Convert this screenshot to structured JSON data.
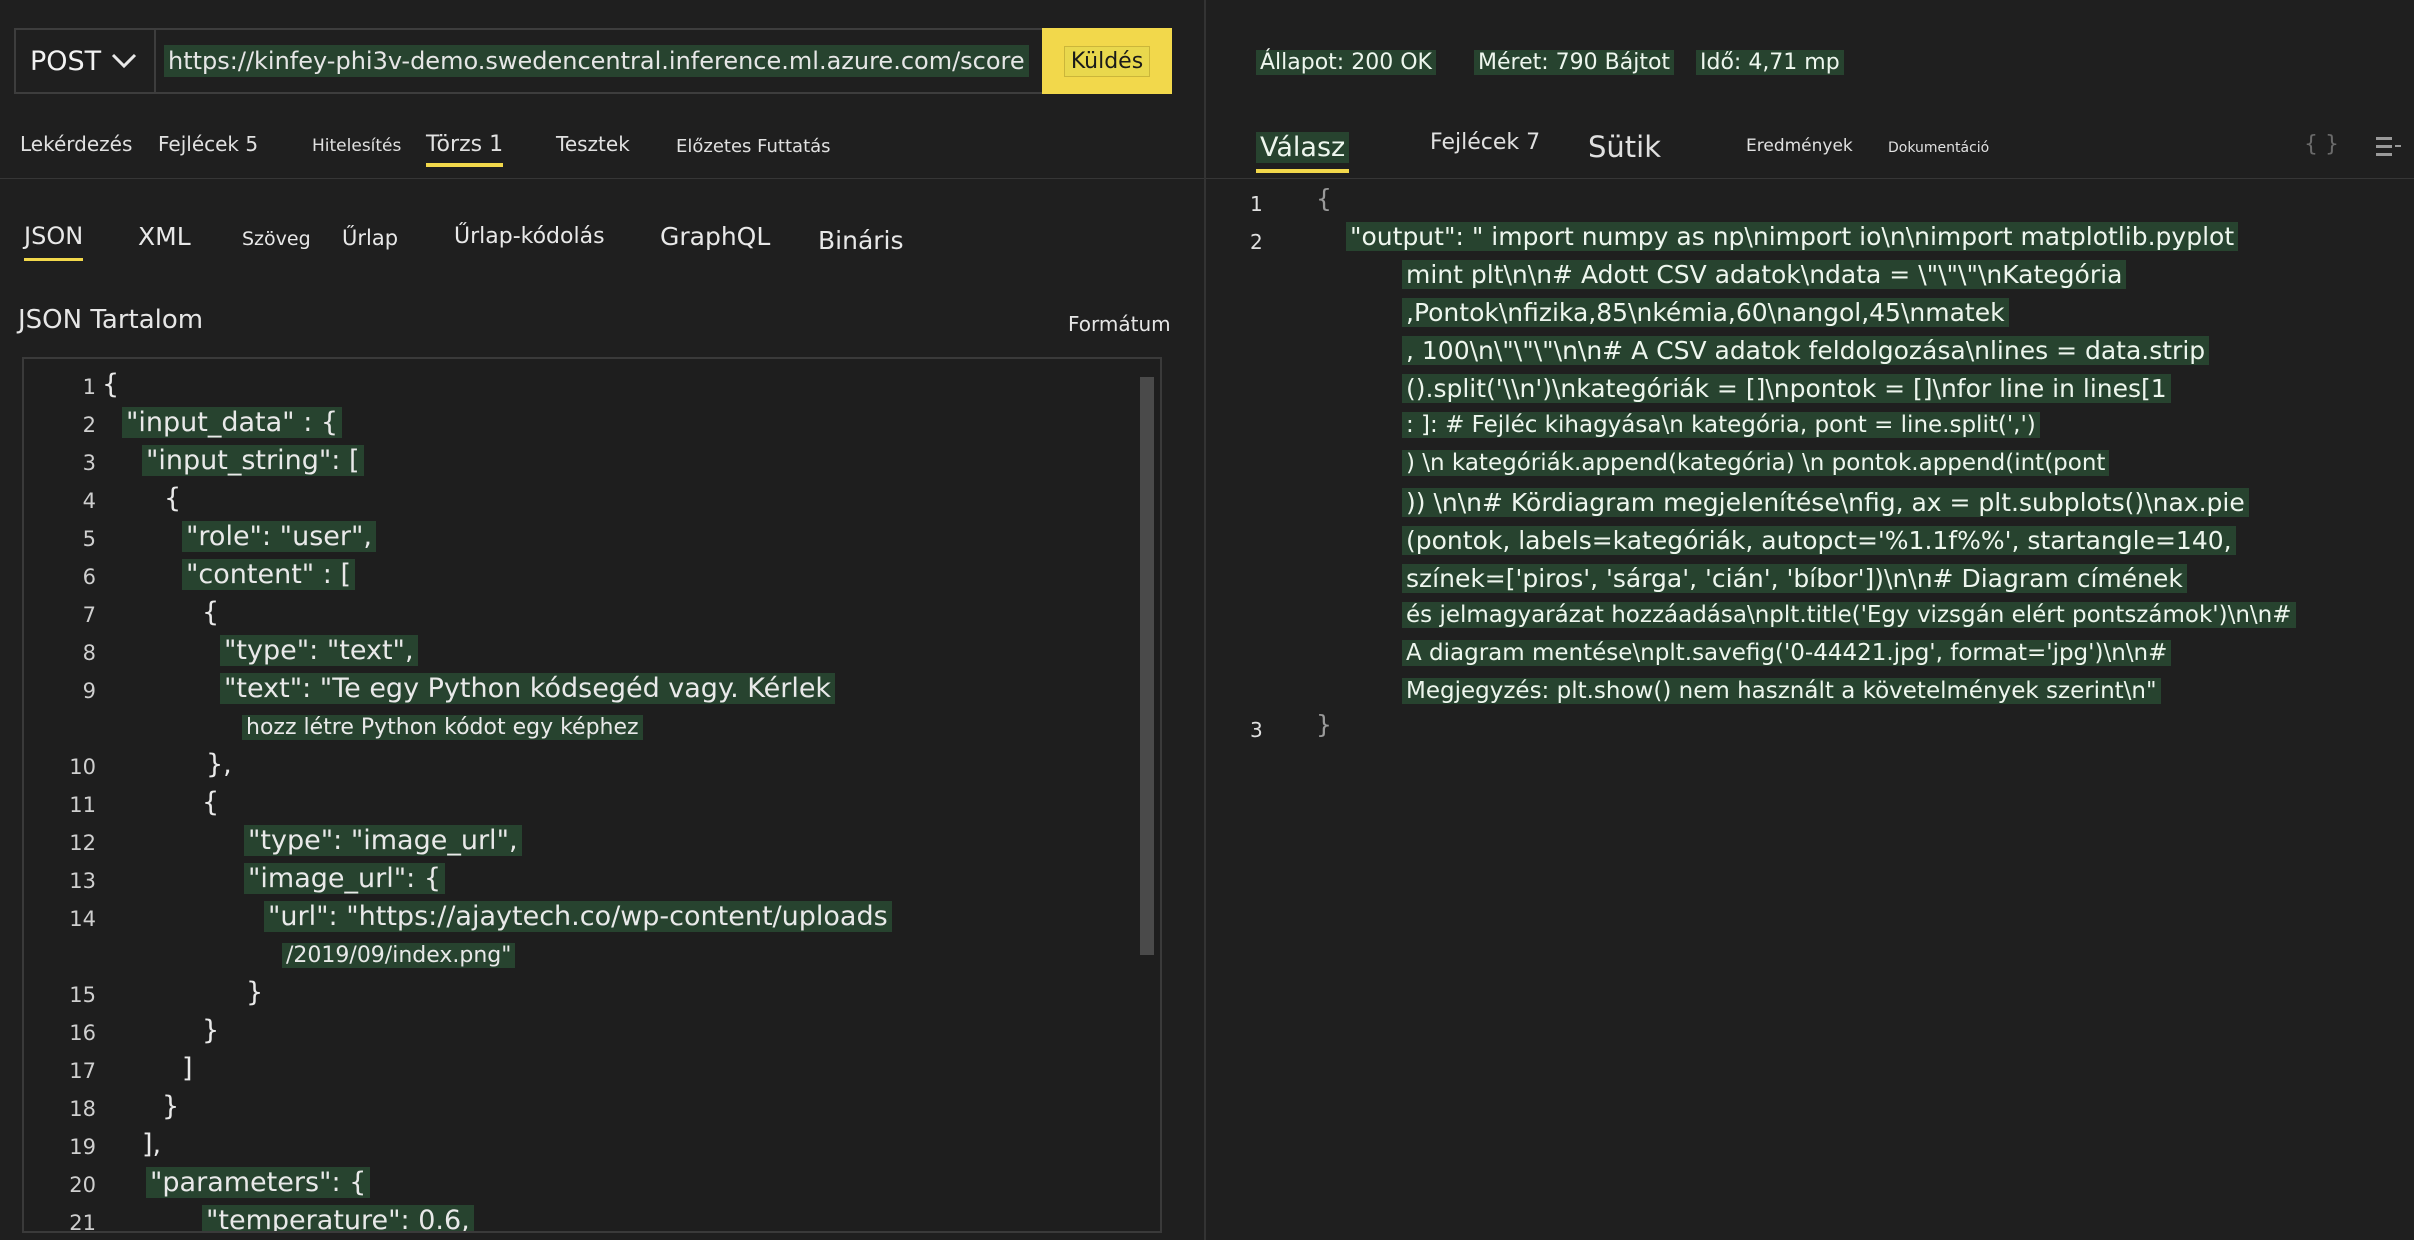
{
  "request": {
    "method": "POST",
    "url": "https://kinfey-phi3v-demo.swedencentral.inference.ml.azure.com/score",
    "send_label": "Küldés",
    "tabs": [
      "Lekérdezés",
      "Fejlécek 5",
      "Hitelesítés",
      "Törzs 1",
      "Tesztek",
      "Előzetes Futtatás"
    ],
    "body_types": [
      "JSON",
      "XML",
      "Szöveg",
      "Űrlap",
      "Űrlap-kódolás",
      "GraphQL",
      "Bináris"
    ],
    "content_label": "JSON Tartalom",
    "format_label": "Formátum",
    "code_lines": [
      {
        "n": "1",
        "t": "{"
      },
      {
        "n": "2",
        "t": "\"input_data\" : {"
      },
      {
        "n": "3",
        "t": "\"input_string\": ["
      },
      {
        "n": "4",
        "t": "{"
      },
      {
        "n": "5",
        "t": "\"role\": \"user\","
      },
      {
        "n": "6",
        "t": "\"content\" : ["
      },
      {
        "n": "7",
        "t": "{"
      },
      {
        "n": "8",
        "t": "\"type\": \"text\","
      },
      {
        "n": "9",
        "t": "\"text\": \"Te egy Python kódsegéd vagy. Kérlek"
      },
      {
        "n": "",
        "t": "hozz létre Python kódot egy képhez"
      },
      {
        "n": "10",
        "t": "},"
      },
      {
        "n": "11",
        "t": "{"
      },
      {
        "n": "12",
        "t": "\"type\": \"image_url\","
      },
      {
        "n": "13",
        "t": "\"image_url\": {"
      },
      {
        "n": "14",
        "t": "\"url\": \"https://ajaytech.co/wp-content/uploads"
      },
      {
        "n": "",
        "t": "/2019/09/index.png\""
      },
      {
        "n": "15",
        "t": "}"
      },
      {
        "n": "16",
        "t": "}"
      },
      {
        "n": "17",
        "t": "]"
      },
      {
        "n": "18",
        "t": "}"
      },
      {
        "n": "19",
        "t": "],"
      },
      {
        "n": "20",
        "t": "\"parameters\": {"
      },
      {
        "n": "21",
        "t": "\"temperature\": 0.6,"
      }
    ]
  },
  "response": {
    "status": "Állapot: 200 OK",
    "size": "Méret: 790 Bájtot",
    "time": "Idő: 4,71 mp",
    "tabs": [
      "Válasz",
      "Fejlécek 7",
      "Sütik",
      "Eredmények",
      "Dokumentáció"
    ],
    "code_lines": [
      {
        "n": "1",
        "t": "{"
      },
      {
        "n": "2",
        "t": "\"output\": \" import numpy as np\\nimport io\\n\\nimport matplotlib.pyplot"
      },
      {
        "n": "",
        "t": "mint plt\\n\\n# Adott CSV adatok\\ndata = \\\"\\\"\\\"\\nKategória"
      },
      {
        "n": "",
        "t": ",Pontok\\nfizika,85\\nkémia,60\\nangol,45\\nmatek"
      },
      {
        "n": "",
        "t": ", 100\\n\\\"\\\"\\\"\\n\\n# A CSV adatok feldolgozása\\nlines = data.strip"
      },
      {
        "n": "",
        "t": "().split('\\\\n')\\nkategóriák = []\\npontok = []\\nfor line in lines[1"
      },
      {
        "n": "",
        "t": ": ]: # Fejléc kihagyása\\n        kategória, pont = line.split(',')"
      },
      {
        "n": "",
        "t": ") \\n      kategóriák.append(kategória) \\n       pontok.append(int(pont"
      },
      {
        "n": "",
        "t": ")) \\n\\n# Kördiagram megjelenítése\\nfig, ax = plt.subplots()\\nax.pie"
      },
      {
        "n": "",
        "t": "(pontok, labels=kategóriák, autopct='%1.1f%%', startangle=140,"
      },
      {
        "n": "",
        "t": "színek=['piros', 'sárga', 'cián', 'bíbor'])\\n\\n# Diagram címének"
      },
      {
        "n": "",
        "t": "és jelmagyarázat hozzáadása\\nplt.title('Egy vizsgán elért pontszámok')\\n\\n#"
      },
      {
        "n": "",
        "t": "A diagram mentése\\nplt.savefig('0-44421.jpg', format='jpg')\\n\\n#"
      },
      {
        "n": "",
        "t": "Megjegyzés: plt.show() nem használt a követelmények szerint\\n\""
      },
      {
        "n": "3",
        "t": "}"
      }
    ]
  }
}
